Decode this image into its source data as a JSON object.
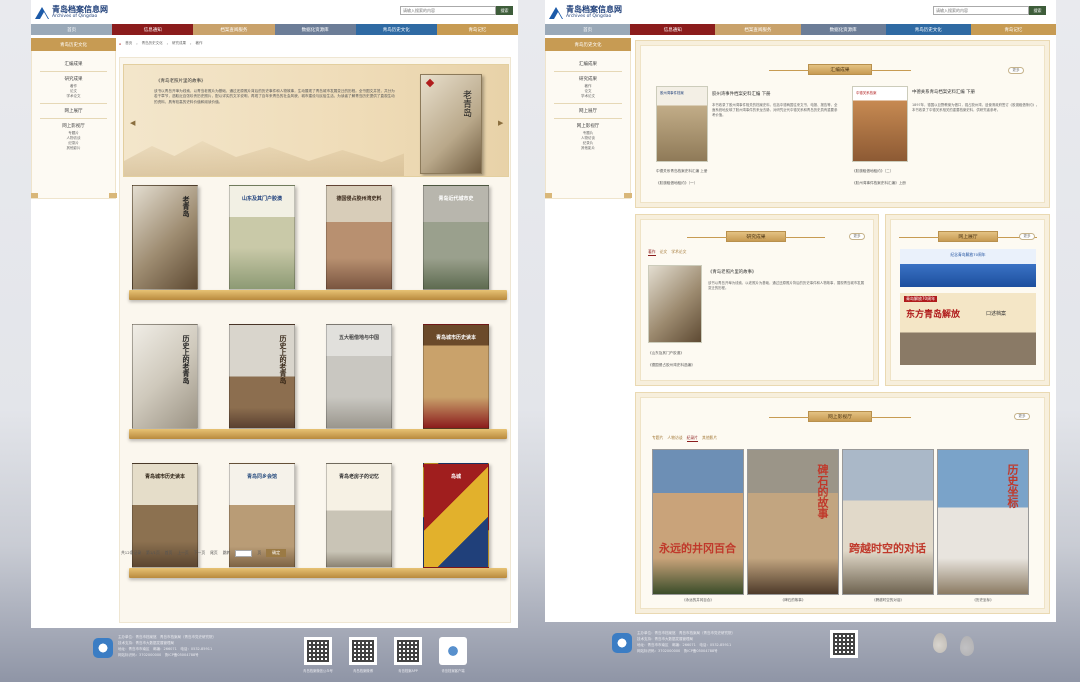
{
  "site": {
    "name_cn": "青岛档案信息网",
    "name_en": "Archives of Qingdao"
  },
  "search": {
    "placeholder": "请输入搜索的内容",
    "button": "搜索"
  },
  "nav": [
    {
      "label": "首页",
      "color": "#9aa9b8"
    },
    {
      "label": "信息通知",
      "color": "#8b1c1c"
    },
    {
      "label": "档案查阅服务",
      "color": "#c9a26b"
    },
    {
      "label": "数据化资源库",
      "color": "#6c7d97"
    },
    {
      "label": "青岛历史文化",
      "color": "#2f6aa3"
    },
    {
      "label": "青岛记忆",
      "color": "#c79b53"
    }
  ],
  "sidebar": {
    "head": "青岛历史文化",
    "items": [
      {
        "label": "汇编成果",
        "subs": []
      },
      {
        "label": "研究成果",
        "subs": [
          "著作",
          "论文",
          "学术论文"
        ]
      },
      {
        "label": "网上展厅",
        "subs": []
      },
      {
        "label": "网上影视厅",
        "subs": [
          "专题片",
          "人物访谈",
          "纪录片",
          "其他影片"
        ]
      }
    ]
  },
  "breadcrumb": [
    "首页",
    "青岛历史文化",
    "研究成果",
    "著作"
  ],
  "hero": {
    "title": "《青岛老照片里的故事》",
    "text": "该书以青岛开埠为线索，以青岛老照片为基础，通过还原照片背后的历史事件和人物故事，生动展现了青岛城市发展变迁的历程。全书图文并茂，共分为若干章节，选取近百张珍贵历史照片，配以详实的文字说明，再现了百年来青岛的社会风貌、城市建设与民俗生活，为读者了解青岛历史提供了直观生动的资料，具有较高的史料价值和阅读价值。",
    "book": "老青岛"
  },
  "books": [
    {
      "title": "老青岛",
      "bg": "linear-gradient(135deg,#e3ddd0,#9d8b70 55%,#5e4a33)",
      "color": "#222",
      "vertical": true
    },
    {
      "title": "山东及其门户胶澳",
      "bg": "linear-gradient(180deg,#f2f0e4 0 30%,#c9c9a8 30% 60%,#8d9a74)",
      "color": "#1d3f7c",
      "vertical": false
    },
    {
      "title": "德国侵占胶州湾史料",
      "bg": "linear-gradient(180deg,#d8cdb9 0 35%,#b89070 35% 70%,#7a5540)",
      "color": "#3b2a1c",
      "vertical": false
    },
    {
      "title": "青岛近代城市史",
      "bg": "linear-gradient(180deg,#b8b6ad 0 35%,#9aa08d 35% 70%,#5e6b50)",
      "color": "#fff",
      "vertical": false
    },
    {
      "title": "历史上的老青岛",
      "bg": "linear-gradient(135deg,#f0ede6,#cfc9bc 50%,#9b9384)",
      "color": "#222",
      "vertical": true
    },
    {
      "title": "历史上的老青岛",
      "bg": "linear-gradient(180deg,#d9d5cc 0 50%,#8c6e4f 50% 80%,#5a4030)",
      "color": "#3a2a1a",
      "vertical": true
    },
    {
      "title": "五大租借地与中国",
      "bg": "linear-gradient(180deg,#e1e0dc 0 30%,#c9c7c1 30% 70%,#9a968d)",
      "color": "#444",
      "vertical": false
    },
    {
      "title": "青岛城市历史读本",
      "bg": "linear-gradient(180deg,#6b4a2a 0 20%,#c9a26b 20% 70%,#8b1c1c)",
      "color": "#fff",
      "vertical": false
    },
    {
      "title": "青岛城市历史读本",
      "bg": "linear-gradient(180deg,#e5ddc9 0 40%,#8c7150 40% 75%,#5b4631)",
      "color": "#2b2013",
      "vertical": false
    },
    {
      "title": "青岛同乡会馆",
      "bg": "linear-gradient(180deg,#f5f2ea 0 40%,#b99c76 40% 80%,#7d6344)",
      "color": "#2b4f80",
      "vertical": false
    },
    {
      "title": "青岛老房子的记忆",
      "bg": "linear-gradient(180deg,#f6f1e4 0 45%,#c9c4b6 45% 85%,#8b8373)",
      "color": "#333",
      "vertical": false
    },
    {
      "title": "岛城",
      "bg": "linear-gradient(135deg,#a01e1e 0 40%,#e2b12c 40% 70%,#20407a 70%)",
      "color": "#fff",
      "vertical": false
    }
  ],
  "pager": {
    "summary": "共12条记录",
    "pages": "第1/1页",
    "first": "首页",
    "prev": "上一页",
    "next": "下一页",
    "last": "尾页",
    "goto": "跳转",
    "page_unit": "页",
    "button": "确定"
  },
  "footer": {
    "lines": [
      "主办单位：青岛市档案馆　青岛市档案局（青岛市党史研究院）",
      "技术支持：青岛市大数据发展管理局",
      "地址：青岛市市南区　邮编：266071　电话：0532-85911",
      "网站标识码：3702000000　鲁ICP备05004788号"
    ],
    "qr": [
      "青岛档案微信公众号",
      "青岛档案微博",
      "青岛档案APP",
      "青岛档案客户端"
    ]
  },
  "p2": {
    "compile": {
      "head": "汇编成果",
      "more": "更多",
      "left": {
        "title": "胶州湾事件档案史料汇编 下册",
        "text": "本书收录了胶州湾事件相关的档案史料，包括中德两国往来文书、电报、报告等，全面系统地反映了胶州湾事件的来龙去脉，对研究近代中德关系和青岛历史具有重要参考价值。",
        "thumb_title": "胶州湾事件档案"
      },
      "right": {
        "title": "中德关系青岛档案史料汇编 下册",
        "text": "1897年，德国以巨野教案为借口，强占胶州湾，迫使清政府签订《胶澳租借条约》。本书收录了中德关系相关的重要档案史料，供研究者参考。",
        "thumb_title": "中德关系档案"
      },
      "bullets": [
        "中德关系青岛档案史料汇编 上册",
        "《胶澳租借地租约》（一）",
        "《胶澳租借地租约》（二）",
        "《胶州湾事件档案史料汇编》上册"
      ]
    },
    "research": {
      "head": "研究成果",
      "more": "更多",
      "tabs": [
        "著作",
        "论文",
        "学术论文"
      ],
      "title": "《青岛老照片里的故事》",
      "text": "该书以青岛开埠为线索，以老照片为基础，通过还原照片背后的历史事件和人物故事，展现青岛城市发展变迁的历程。",
      "bullets": [
        "《山东及其门户胶澳》",
        "《德国侵占胶州湾史料选编》"
      ]
    },
    "hall": {
      "head": "网上展厅",
      "more": "更多",
      "banner1": "纪念青岛解放70周年",
      "banner2": "青岛解放70周年",
      "banner2b": "东方青岛解放",
      "banner2c": "口述档案"
    },
    "film": {
      "head": "网上影视厅",
      "more": "更多",
      "tabs": [
        "专题片",
        "人物访谈",
        "纪录片",
        "其他影片"
      ],
      "posters": [
        {
          "title": "永远的井冈百合",
          "cap": "《永远的井冈百合》"
        },
        {
          "title": "碑石的故事",
          "cap": "《碑石的故事》"
        },
        {
          "title": "跨越时空的对话",
          "cap": "《跨越时空的对话》"
        },
        {
          "title": "历史坐标",
          "cap": "《历史坐标》"
        }
      ]
    }
  }
}
